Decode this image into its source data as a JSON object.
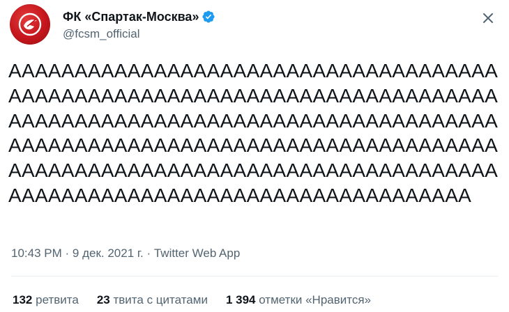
{
  "tweet": {
    "author": {
      "display_name": "ФК «Спартак-Москва»",
      "handle": "@fcsm_official",
      "verified": true,
      "avatar_icon": "spartak-logo-icon",
      "avatar_color": "#c4161c"
    },
    "text": "АААААААААААААААААААААААААААААААААААААААААААААААААААААААААААААААААААААААААААААААААААААААААААААААААААААААААААААААААААААААААААААААААААААААААААААААААААААААААААААААААААААААААААААААААААААААААААААААААААААААААААААААААААААААААААА",
    "time": "10:43 PM",
    "date": "9 дек. 2021 г.",
    "separator": "·",
    "source": "Twitter Web App",
    "stats": {
      "retweets_count": "132",
      "retweets_label": "ретвита",
      "quotes_count": "23",
      "quotes_label": "твита с цитатами",
      "likes_count": "1 394",
      "likes_label": "отметки «Нравится»"
    }
  },
  "icons": {
    "close": "close-icon",
    "verified": "verified-badge-icon"
  },
  "colors": {
    "verified_blue": "#1d9bf0",
    "secondary_text": "#536471",
    "primary_text": "#0f1419"
  }
}
